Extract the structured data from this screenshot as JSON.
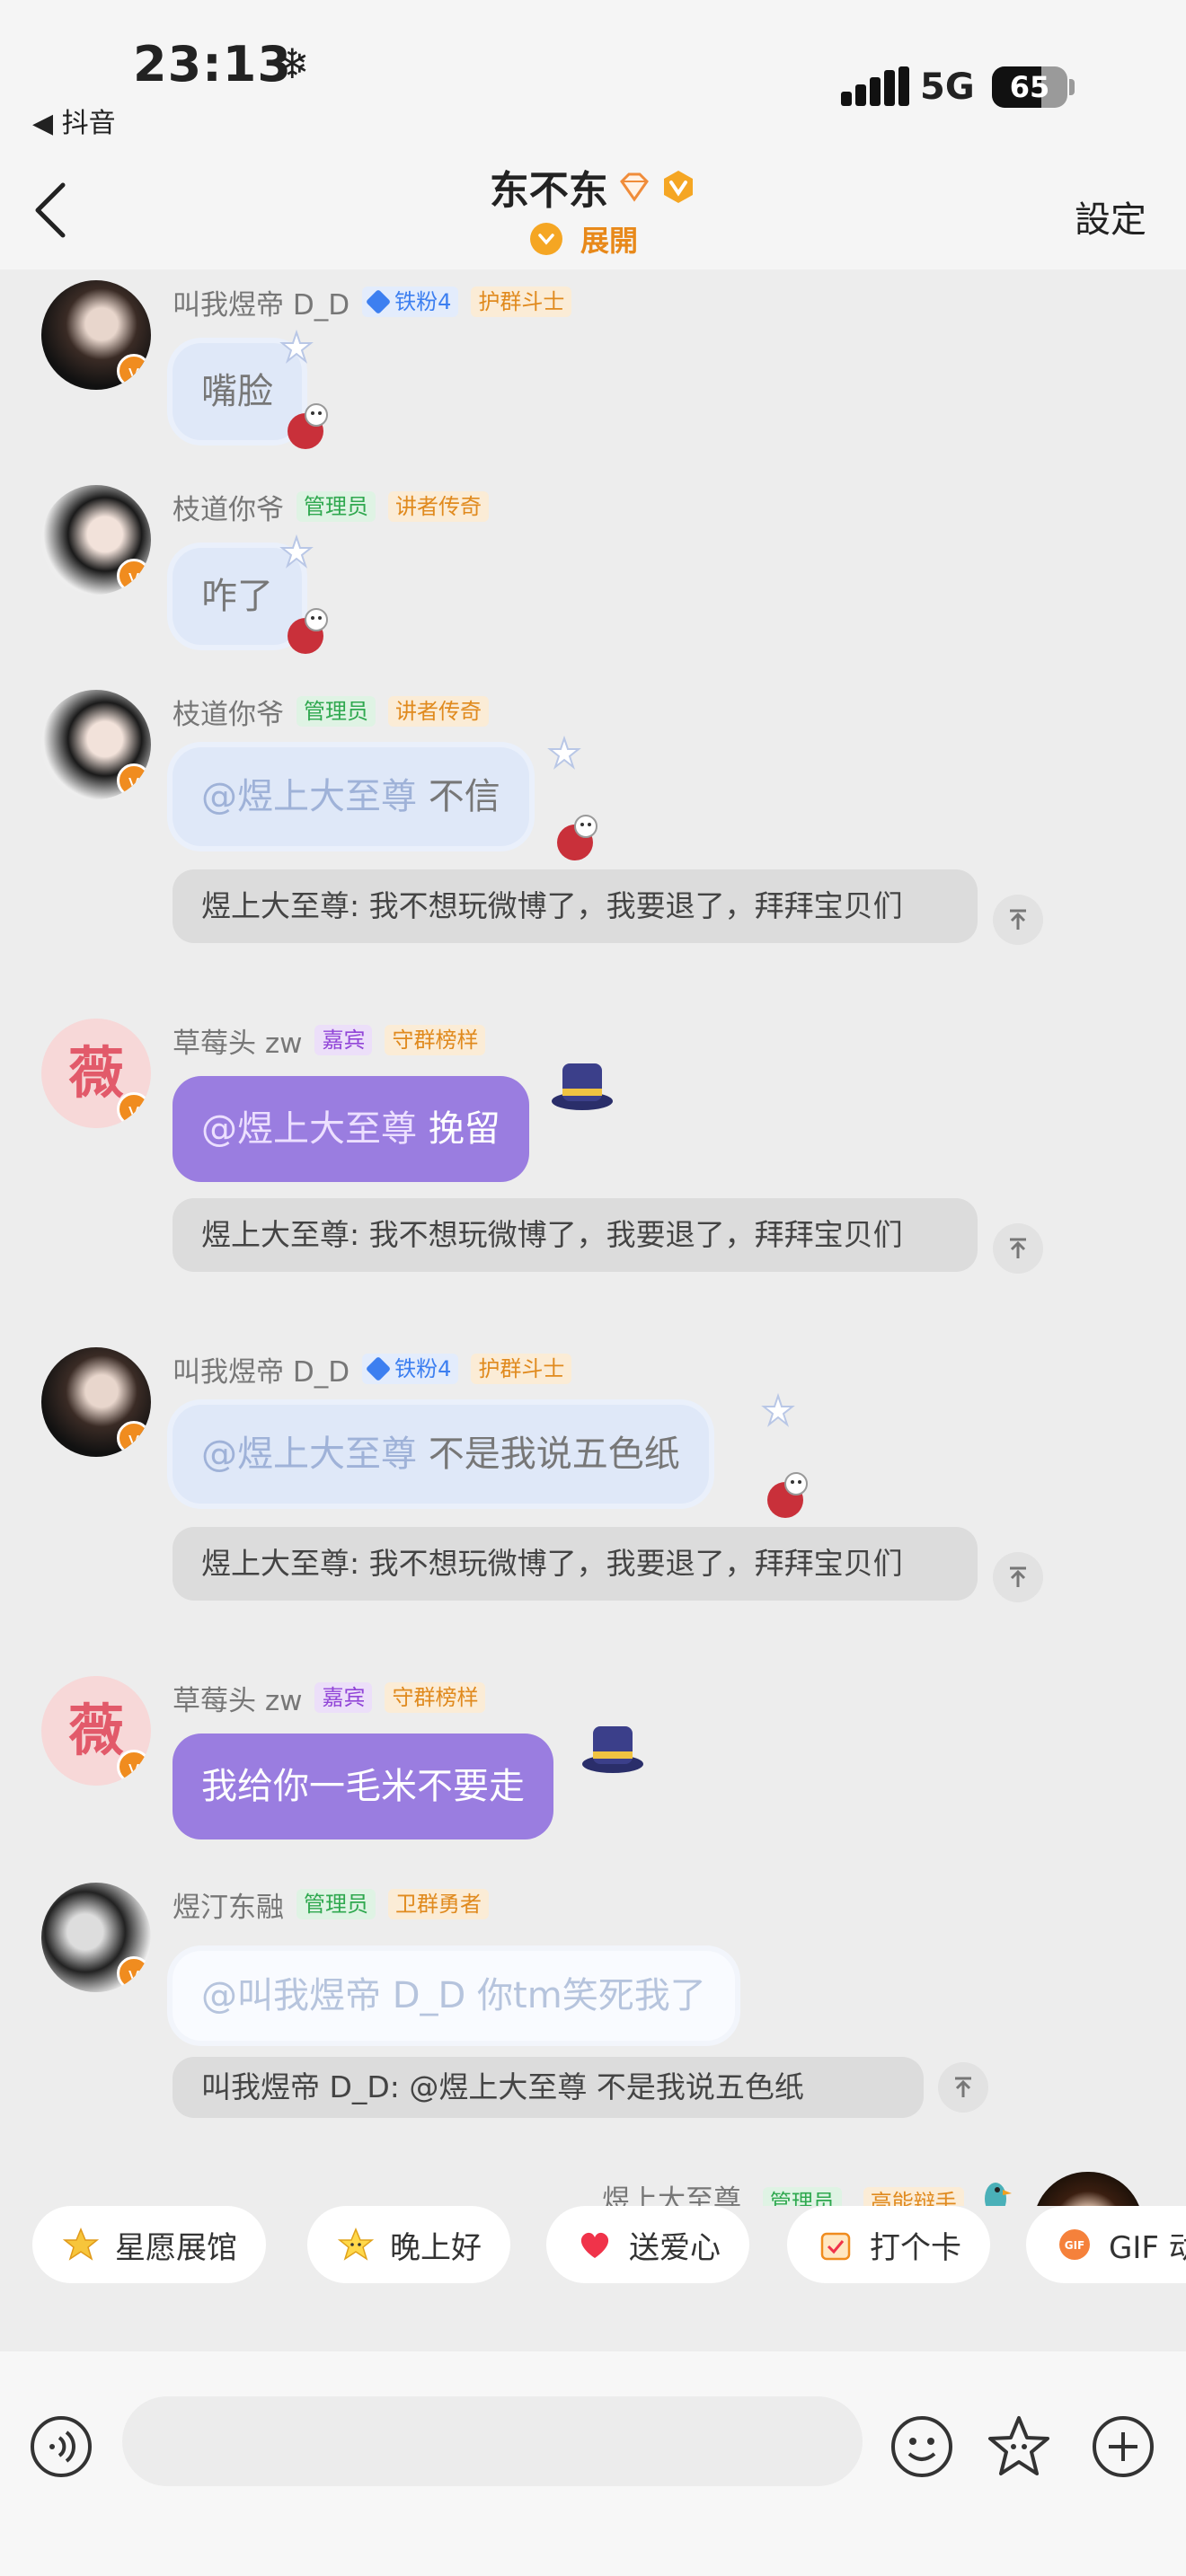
{
  "status_bar": {
    "time": "23:13",
    "snow_glyph": "❄",
    "back_app": "◀ 抖音",
    "network": "5G",
    "battery": "65",
    "battery_fraction": 0.65
  },
  "header": {
    "title": "东不东",
    "expand_label": "展開",
    "settings_label": "設定"
  },
  "quote_text": "煜上大至尊: 我不想玩微博了，我要退了，拜拜宝贝们",
  "messages": [
    {
      "name": "叫我煜帝 D_D",
      "tags": [
        "铁粉4",
        "护群斗士"
      ],
      "text": "嘴脸"
    },
    {
      "name": "枝道你爷",
      "tags": [
        "管理员",
        "讲者传奇"
      ],
      "text": "咋了"
    },
    {
      "name": "枝道你爷",
      "tags": [
        "管理员",
        "讲者传奇"
      ],
      "mention": "@煜上大至尊",
      "text": "不信",
      "quote": "煜上大至尊: 我不想玩微博了，我要退了，拜拜宝贝们"
    },
    {
      "name": "草莓头 zw",
      "avatar_char": "薇",
      "tags": [
        "嘉宾",
        "守群榜样"
      ],
      "mention": "@煜上大至尊",
      "text": "挽留",
      "quote": "煜上大至尊: 我不想玩微博了，我要退了，拜拜宝贝们"
    },
    {
      "name": "叫我煜帝 D_D",
      "tags": [
        "铁粉4",
        "护群斗士"
      ],
      "mention": "@煜上大至尊",
      "text": "不是我说五色纸",
      "quote": "煜上大至尊: 我不想玩微博了，我要退了，拜拜宝贝们"
    },
    {
      "name": "草莓头 zw",
      "avatar_char": "薇",
      "tags": [
        "嘉宾",
        "守群榜样"
      ],
      "text": "我给你一毛米不要走"
    },
    {
      "name": "煜汀东融",
      "tags": [
        "管理员",
        "卫群勇者"
      ],
      "mention": "@叫我煜帝 D_D",
      "text": "你tm笑死我了",
      "quote": "叫我煜帝 D_D: @煜上大至尊 不是我说五色纸"
    }
  ],
  "self": {
    "name": "煜上大至尊",
    "tags": [
      "管理员",
      "高能辩手"
    ]
  },
  "quick_actions": [
    "星愿展馆",
    "晚上好",
    "送爱心",
    "打个卡",
    "GIF 动"
  ],
  "icons": [
    "back-chevron-icon",
    "voice-icon",
    "emoji-icon",
    "sticker-icon",
    "plus-icon",
    "pin-top-icon"
  ],
  "colors": {
    "purple_bubble": "#9a7de0",
    "cloud_bubble": "#dfe8f8",
    "accent_orange": "#e8891a"
  }
}
